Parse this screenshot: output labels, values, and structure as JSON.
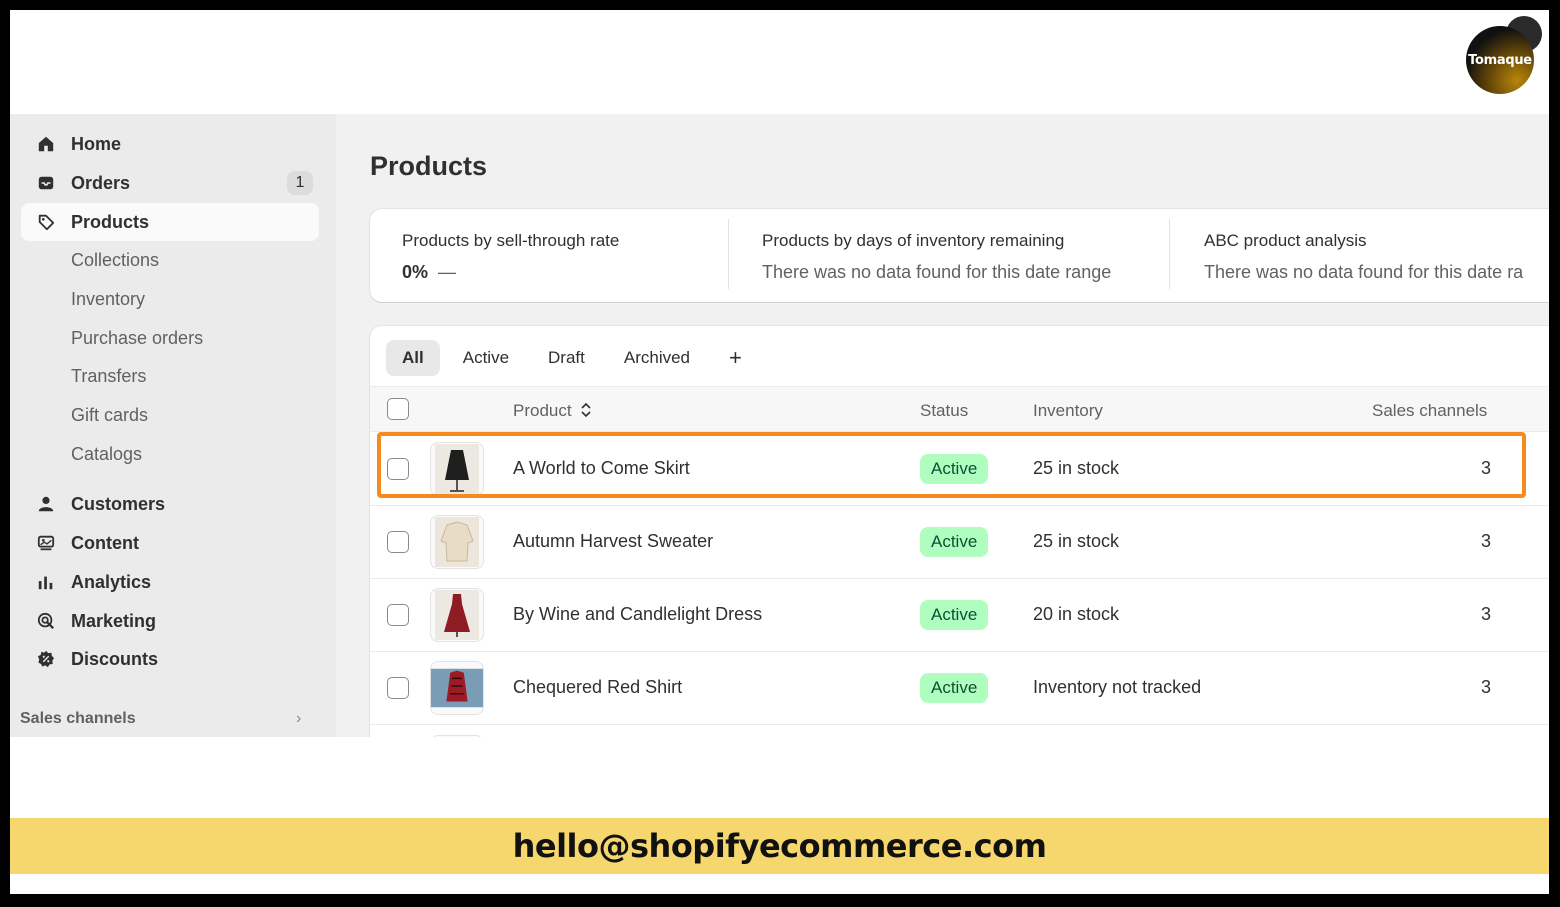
{
  "logo": {
    "text": "Tomaque"
  },
  "sidebar": {
    "items": [
      {
        "label": "Home",
        "icon": "home-icon"
      },
      {
        "label": "Orders",
        "icon": "inbox-icon",
        "badge": "1"
      },
      {
        "label": "Products",
        "icon": "tag-icon",
        "active": true
      },
      {
        "label": "Collections",
        "sub": true
      },
      {
        "label": "Inventory",
        "sub": true
      },
      {
        "label": "Purchase orders",
        "sub": true
      },
      {
        "label": "Transfers",
        "sub": true
      },
      {
        "label": "Gift cards",
        "sub": true
      },
      {
        "label": "Catalogs",
        "sub": true
      },
      {
        "label": "Customers",
        "icon": "person-icon"
      },
      {
        "label": "Content",
        "icon": "content-icon"
      },
      {
        "label": "Analytics",
        "icon": "bar-chart-icon"
      },
      {
        "label": "Marketing",
        "icon": "target-icon"
      },
      {
        "label": "Discounts",
        "icon": "discount-icon"
      }
    ],
    "sales_channels": "Sales channels"
  },
  "page": {
    "title": "Products"
  },
  "metrics": [
    {
      "title": "Products by sell-through rate",
      "value": "0%",
      "dash": "—"
    },
    {
      "title": "Products by days of inventory remaining",
      "value": "There was no data found for this date range"
    },
    {
      "title": "ABC product analysis",
      "value": "There was no data found for this date ra"
    }
  ],
  "tabs": [
    "All",
    "Active",
    "Draft",
    "Archived",
    "+"
  ],
  "table": {
    "headers": {
      "product": "Product",
      "status": "Status",
      "inventory": "Inventory",
      "channels": "Sales channels"
    },
    "rows": [
      {
        "product": "A World to Come Skirt",
        "status": "Active",
        "inventory": "25 in stock",
        "channels": "3"
      },
      {
        "product": "Autumn Harvest Sweater",
        "status": "Active",
        "inventory": "25 in stock",
        "channels": "3"
      },
      {
        "product": "By Wine and Candlelight Dress",
        "status": "Active",
        "inventory": "20 in stock",
        "channels": "3"
      },
      {
        "product": "Chequered Red Shirt",
        "status": "Active",
        "inventory": "Inventory not tracked",
        "channels": "3"
      }
    ]
  },
  "footer": {
    "email": "hello@shopifyecommerce.com"
  },
  "colors": {
    "highlight": "#f58b1f",
    "status_bg": "#affebf",
    "email_bar": "#f5d76e"
  }
}
